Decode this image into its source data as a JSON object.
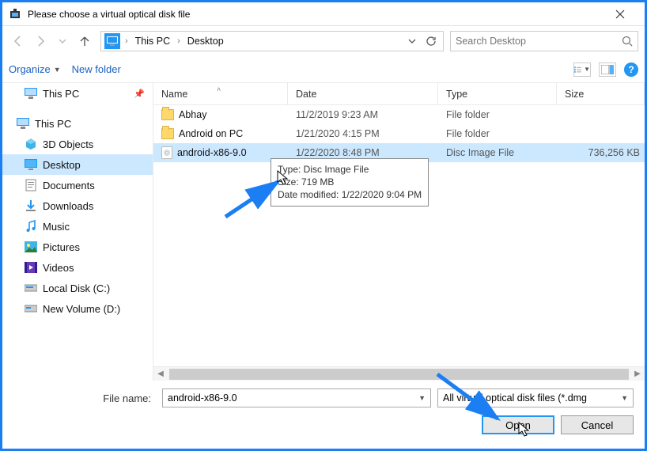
{
  "titlebar": {
    "title": "Please choose a virtual optical disk file"
  },
  "breadcrumb": {
    "root": "This PC",
    "items": [
      "Desktop"
    ]
  },
  "search": {
    "placeholder": "Search Desktop"
  },
  "toolbar": {
    "organize": "Organize",
    "newfolder": "New folder"
  },
  "tree": {
    "quick": {
      "label": "This PC"
    },
    "root": "This PC",
    "items": [
      {
        "label": "3D Objects"
      },
      {
        "label": "Desktop",
        "selected": true
      },
      {
        "label": "Documents"
      },
      {
        "label": "Downloads"
      },
      {
        "label": "Music"
      },
      {
        "label": "Pictures"
      },
      {
        "label": "Videos"
      },
      {
        "label": "Local Disk (C:)"
      },
      {
        "label": "New Volume (D:)"
      }
    ]
  },
  "columns": {
    "name": "Name",
    "date": "Date",
    "type": "Type",
    "size": "Size"
  },
  "rows": [
    {
      "name": "Abhay",
      "date": "11/2/2019 9:23 AM",
      "type": "File folder",
      "size": "",
      "kind": "folder"
    },
    {
      "name": "Android on PC",
      "date": "1/21/2020 4:15 PM",
      "type": "File folder",
      "size": "",
      "kind": "folder"
    },
    {
      "name": "android-x86-9.0",
      "date": "1/22/2020 8:48 PM",
      "type": "Disc Image File",
      "size": "736,256 KB",
      "kind": "disc",
      "selected": true
    }
  ],
  "tooltip": {
    "line1": "Type: Disc Image File",
    "line2": "Size: 719 MB",
    "line3": "Date modified: 1/22/2020 9:04 PM"
  },
  "footer": {
    "filename_label": "File name:",
    "filename_value": "android-x86-9.0",
    "filter": "All virtual optical disk files (*.dmg",
    "open": "Open",
    "cancel": "Cancel"
  }
}
